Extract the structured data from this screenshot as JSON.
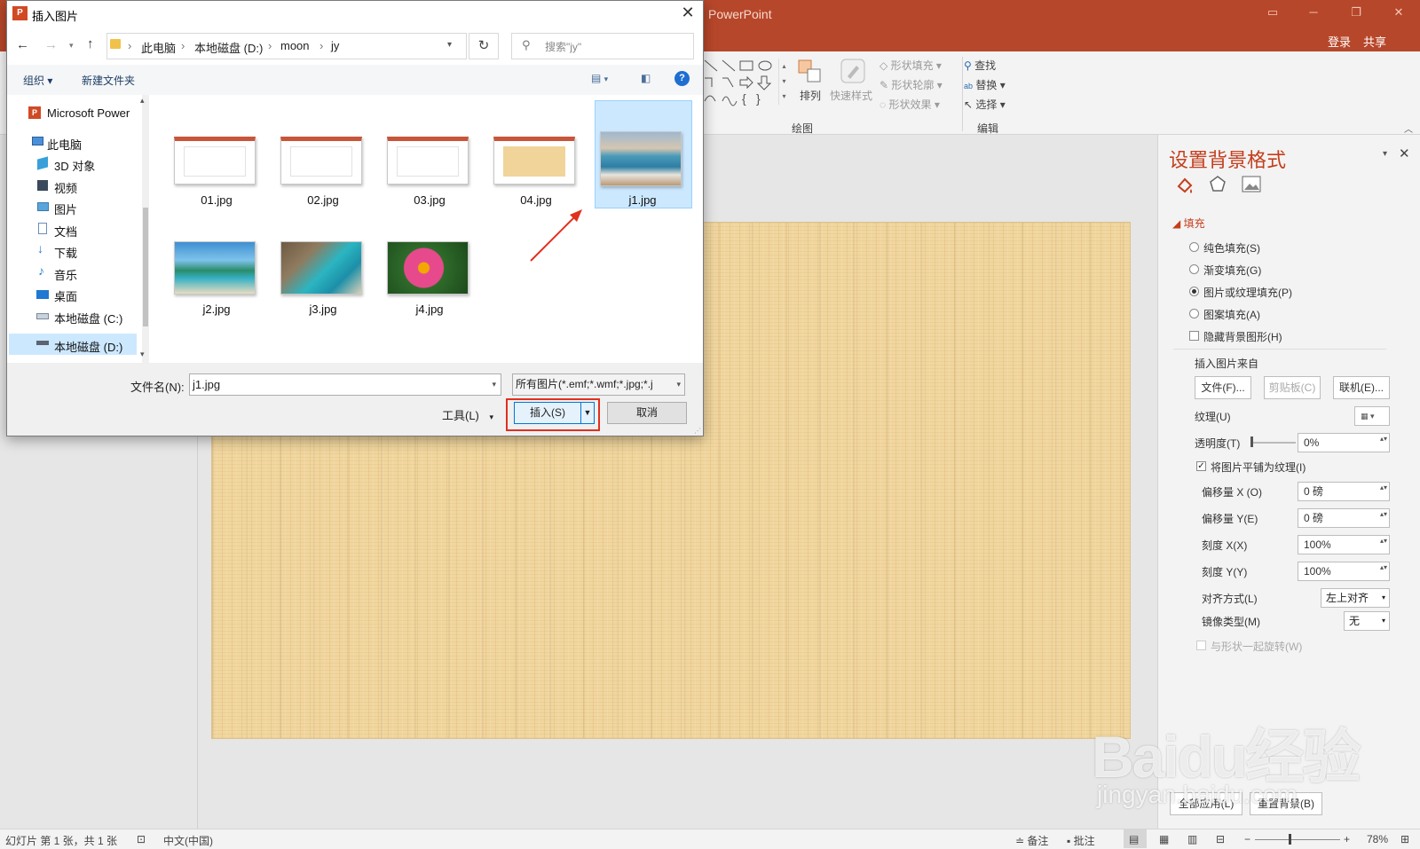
{
  "app": {
    "title_fragment": "PowerPoint",
    "login": "登录",
    "share": "共享"
  },
  "ribbon": {
    "arrange": "排列",
    "quick_styles": "快速样式",
    "shape_fill": "形状填充",
    "shape_outline": "形状轮廓",
    "shape_effects": "形状效果",
    "group_drawing": "绘图",
    "find": "查找",
    "replace": "替换",
    "select": "选择",
    "group_editing": "编辑"
  },
  "dialog": {
    "title": "插入图片",
    "breadcrumb": [
      "此电脑",
      "本地磁盘 (D:)",
      "moon",
      "jy"
    ],
    "search_placeholder": "搜索\"jy\"",
    "organize": "组织",
    "new_folder": "新建文件夹",
    "nav": [
      "Microsoft Power",
      "此电脑",
      "3D 对象",
      "视频",
      "图片",
      "文档",
      "下载",
      "音乐",
      "桌面",
      "本地磁盘 (C:)",
      "本地磁盘 (D:)"
    ],
    "files": [
      "01.jpg",
      "02.jpg",
      "03.jpg",
      "04.jpg",
      "j1.jpg",
      "j2.jpg",
      "j3.jpg",
      "j4.jpg"
    ],
    "filename_label": "文件名(N):",
    "filename_value": "j1.jpg",
    "filetype": "所有图片(*.emf;*.wmf;*.jpg;*.j",
    "tools": "工具(L)",
    "insert": "插入(S)",
    "cancel": "取消"
  },
  "pane": {
    "title": "设置背景格式",
    "fill": "填充",
    "solid": "纯色填充(S)",
    "gradient": "渐变填充(G)",
    "picture": "图片或纹理填充(P)",
    "pattern": "图案填充(A)",
    "hide_bg": "隐藏背景图形(H)",
    "insert_from": "插入图片来自",
    "file_btn": "文件(F)...",
    "clipboard_btn": "剪贴板(C)",
    "online_btn": "联机(E)...",
    "texture": "纹理(U)",
    "transparency": "透明度(T)",
    "transparency_val": "0%",
    "tile": "将图片平铺为纹理(I)",
    "offset_x": "偏移量 X (O)",
    "offset_x_val": "0 磅",
    "offset_y": "偏移量 Y(E)",
    "offset_y_val": "0 磅",
    "scale_x": "刻度 X(X)",
    "scale_x_val": "100%",
    "scale_y": "刻度 Y(Y)",
    "scale_y_val": "100%",
    "align": "对齐方式(L)",
    "align_val": "左上对齐",
    "mirror": "镜像类型(M)",
    "mirror_val": "无",
    "rotate": "与形状一起旋转(W)",
    "apply_all": "全部应用(L)",
    "reset": "重置背景(B)"
  },
  "status": {
    "slide": "幻灯片 第 1 张，共 1 张",
    "lang": "中文(中国)",
    "notes": "备注",
    "comments": "批注",
    "zoom": "78%"
  },
  "watermark": {
    "logo": "Baidu经验",
    "url": "jingyan.baidu.com"
  }
}
